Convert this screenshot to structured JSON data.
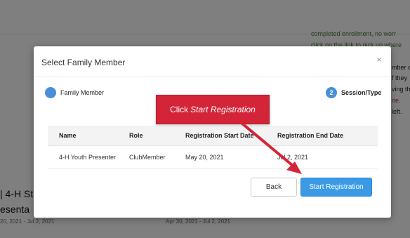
{
  "background": {
    "right_lines": [
      {
        "text": "completed enrollment, no worr",
        "style": "green"
      },
      {
        "text": "click on the link to pick up where",
        "style": "green"
      },
      {
        "text": "mber c",
        "style": "dark"
      },
      {
        "text": "f they",
        "style": "dark"
      },
      {
        "text": "ving th",
        "style": "dark"
      },
      {
        "text": "ne.",
        "style": "red"
      },
      {
        "text": "left.",
        "style": "dark"
      }
    ],
    "left_title_1": "| 4-H St",
    "left_title_2": "esenta",
    "left_dates": "20, 2021 - Jul 2, 2021",
    "mid_dates": "Apr 30, 2021 - Jul 2, 2021"
  },
  "modal": {
    "title": "Select Family Member",
    "close_symbol": "×",
    "steps": [
      {
        "number": "",
        "label": "Family Member"
      },
      {
        "number": "2",
        "label": "Session/Type"
      }
    ],
    "table": {
      "headers": [
        "Name",
        "Role",
        "Registration Start Date",
        "Registration End Date"
      ],
      "rows": [
        [
          "4-H Youth Presenter",
          "ClubMember",
          "May 20, 2021",
          "Jul 2, 2021"
        ]
      ]
    },
    "back_label": "Back",
    "start_label": "Start Registration"
  },
  "callout": {
    "prefix": "Click",
    "command": "Start Registration"
  },
  "colors": {
    "accent": "#3b9ae6",
    "callout": "#d42438"
  }
}
